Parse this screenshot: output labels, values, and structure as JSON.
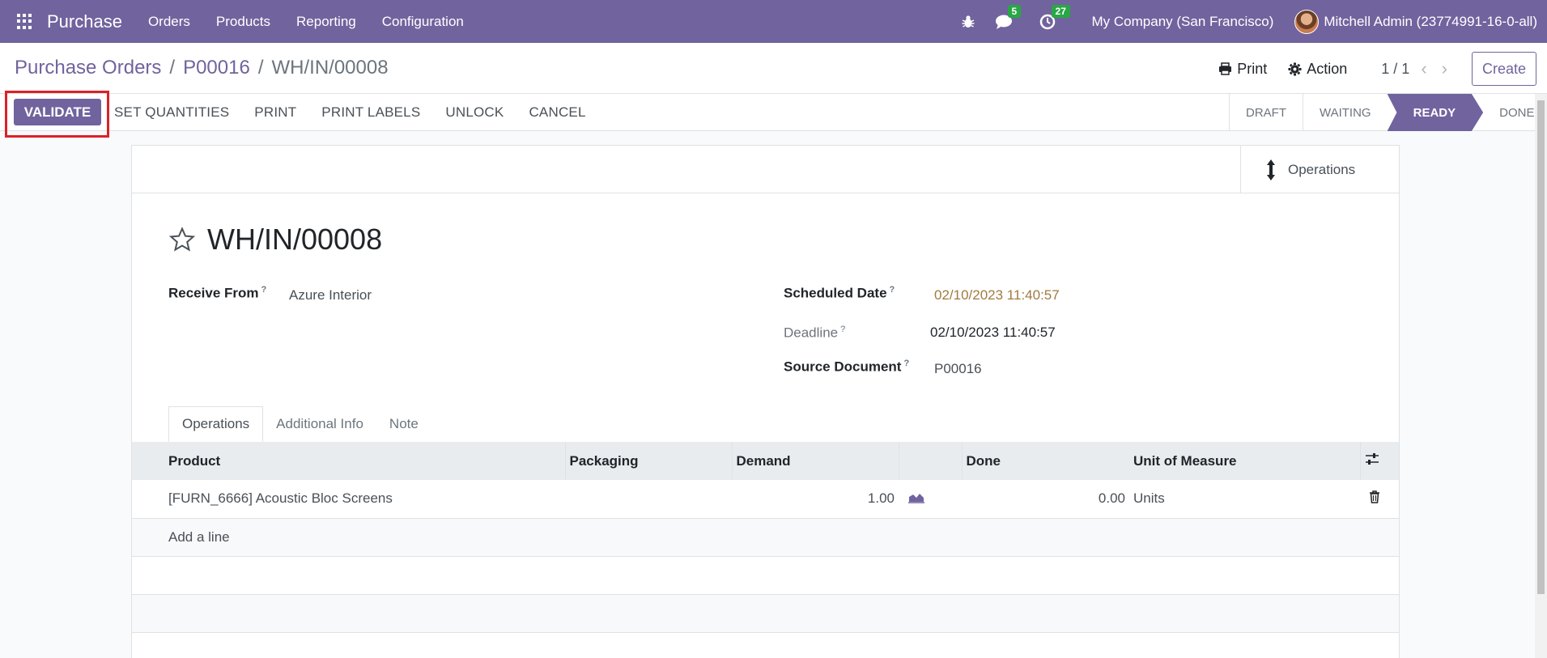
{
  "topbar": {
    "app_name": "Purchase",
    "menu": [
      "Orders",
      "Products",
      "Reporting",
      "Configuration"
    ],
    "messages_count": "5",
    "activities_count": "27",
    "company": "My Company (San Francisco)",
    "user": "Mitchell Admin (23774991-16-0-all)"
  },
  "control": {
    "breadcrumb": [
      "Purchase Orders",
      "P00016",
      "WH/IN/00008"
    ],
    "print_label": "Print",
    "action_label": "Action",
    "pager": "1 / 1",
    "create_label": "Create"
  },
  "statusbar": {
    "validate_label": "VALIDATE",
    "actions": [
      "SET QUANTITIES",
      "PRINT",
      "PRINT LABELS",
      "UNLOCK",
      "CANCEL"
    ],
    "stages": [
      "DRAFT",
      "WAITING",
      "READY",
      "DONE"
    ],
    "active_stage": "READY"
  },
  "sheet": {
    "smart_button": "Operations",
    "title": "WH/IN/00008",
    "receive_from_label": "Receive From",
    "receive_from": "Azure Interior",
    "scheduled_date_label": "Scheduled Date",
    "scheduled_date": "02/10/2023 11:40:57",
    "deadline_label": "Deadline",
    "deadline": "02/10/2023 11:40:57",
    "source_document_label": "Source Document",
    "source_document": "P00016",
    "help_mark": "?",
    "tabs": [
      "Operations",
      "Additional Info",
      "Note"
    ]
  },
  "table": {
    "columns": [
      "Product",
      "Packaging",
      "Demand",
      "Done",
      "Unit of Measure"
    ],
    "rows": [
      {
        "product": "[FURN_6666] Acoustic Bloc Screens",
        "packaging": "",
        "demand": "1.00",
        "done": "0.00",
        "uom": "Units"
      }
    ],
    "add_line": "Add a line"
  },
  "colors": {
    "brand": "#71639e",
    "highlight": "#dc2127",
    "badge": "#28a745"
  }
}
